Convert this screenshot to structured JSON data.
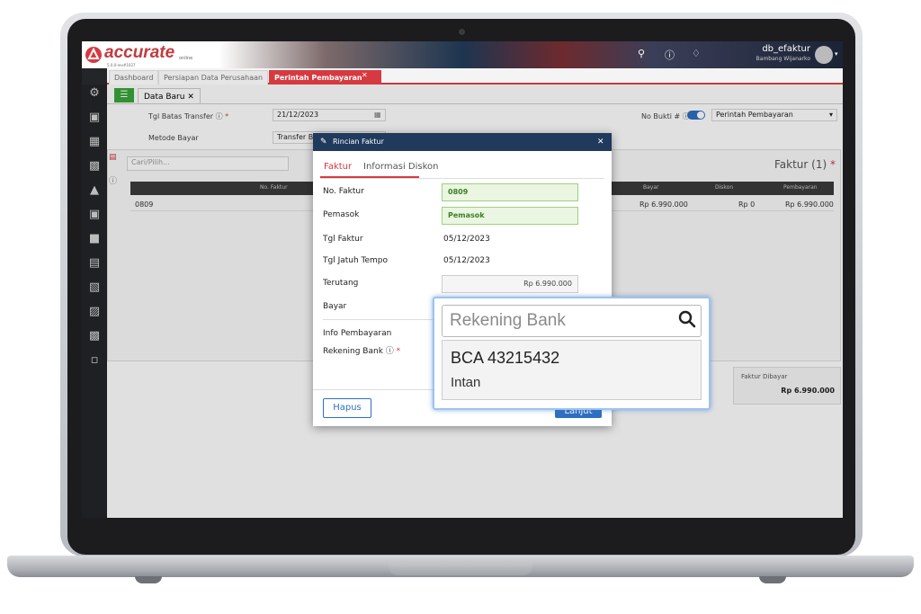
{
  "app": {
    "logo_text": "accurate",
    "logo_sub": "online",
    "version": "5.0.0-rev#1027",
    "db_name": "db_efaktur",
    "user_name": "Bambang Wijanarko"
  },
  "tabs": [
    {
      "label": "Dashboard"
    },
    {
      "label": "Persiapan Data Perusahaan"
    },
    {
      "label": "Perintah Pembayaran"
    }
  ],
  "subtab": {
    "label": "Data Baru"
  },
  "form": {
    "tgl_batas_label": "Tgl Batas Transfer",
    "tgl_batas_value": "21/12/2023",
    "metode_label": "Metode Bayar",
    "metode_value": "Transfer Bank",
    "no_bukti_label": "No Bukti #",
    "no_bukti_value": "Perintah Pembayaran"
  },
  "grid": {
    "search_placeholder": "Cari/Pilih...",
    "title": "Faktur (1)",
    "headers": [
      "No. Faktur",
      "Bayar",
      "Diskon",
      "Pembayaran"
    ],
    "row": {
      "no": "0809",
      "bayar": "Rp 6.990.000",
      "diskon": "Rp 0",
      "pembayaran": "Rp 6.990.000"
    },
    "total_label": "Faktur Dibayar",
    "total_value": "Rp 6.990.000"
  },
  "modal": {
    "title": "Rincian Faktur",
    "tab_active": "Faktur",
    "tab_other": "Informasi Diskon",
    "fields": {
      "no_faktur_label": "No. Faktur",
      "no_faktur_value": "0809",
      "pemasok_label": "Pemasok",
      "pemasok_value": "Pemasok",
      "tgl_faktur_label": "Tgl Faktur",
      "tgl_faktur_value": "05/12/2023",
      "jatuh_tempo_label": "Tgl Jatuh Tempo",
      "jatuh_tempo_value": "05/12/2023",
      "terutang_label": "Terutang",
      "terutang_value": "Rp 6.990.000",
      "bayar_label": "Bayar",
      "info_label": "Info Pembayaran",
      "rekening_label": "Rekening Bank"
    },
    "hapus_label": "Hapus",
    "lanjut_label": "Lanjut"
  },
  "dropdown": {
    "placeholder": "Rekening Bank",
    "option_title": "BCA 43215432",
    "option_sub": "Intan"
  },
  "colors": {
    "accent_red": "#d63a40",
    "modal_header": "#1f3a5c",
    "valid_green": "#9ad37e"
  }
}
